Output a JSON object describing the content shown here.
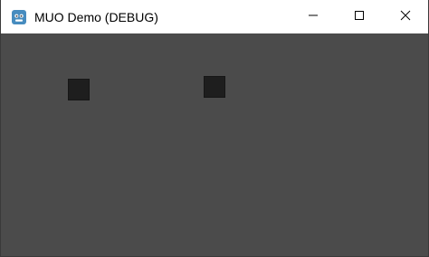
{
  "window": {
    "title": "MUO Demo (DEBUG)",
    "app_icon": "godot-engine-icon",
    "controls": {
      "minimize_icon": "minimize-icon",
      "maximize_icon": "maximize-icon",
      "close_icon": "close-icon"
    }
  },
  "colors": {
    "titlebar": "#ffffff",
    "viewport_background": "#4b4b4b",
    "block": "#1e1e1e",
    "app_icon_accent": "#478cbf"
  },
  "scene": {
    "objects": [
      {
        "name": "dark-square-1"
      },
      {
        "name": "dark-square-2"
      }
    ]
  }
}
